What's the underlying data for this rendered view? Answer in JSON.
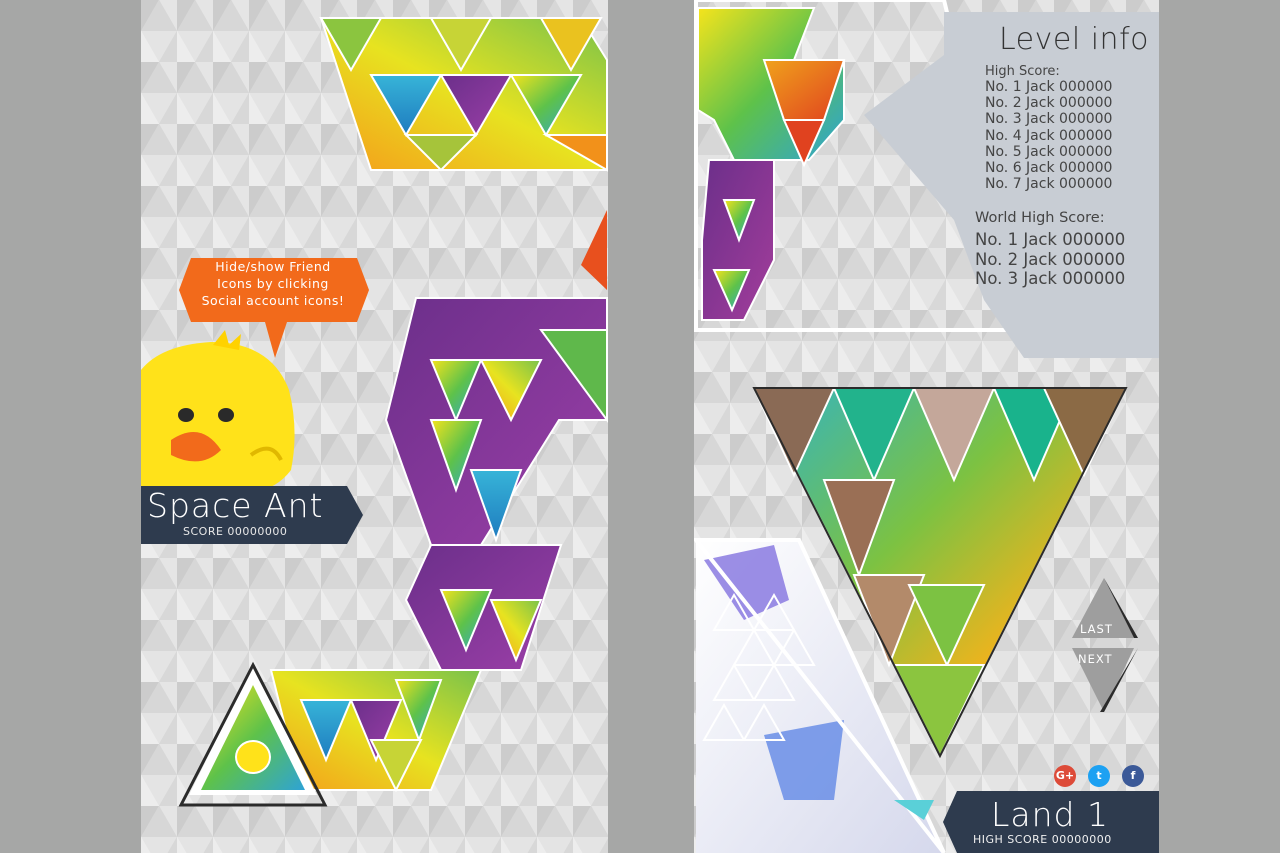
{
  "left_screen": {
    "tooltip_lines": [
      "Hide/show Friend",
      "Icons by clicking",
      "Social account icons!"
    ],
    "player_name": "Space Ant",
    "score_text": "SCORE 00000000",
    "character": "chick-character"
  },
  "right_screen": {
    "level_info_title": "Level info",
    "high_score_label": "High Score:",
    "high_scores": [
      "No. 1 Jack 000000",
      "No. 2 Jack 000000",
      "No. 3 Jack 000000",
      "No. 4 Jack 000000",
      "No. 5 Jack 000000",
      "No. 6 Jack 000000",
      "No. 7 Jack 000000"
    ],
    "world_high_score_label": "World High Score:",
    "world_high_scores": [
      "No. 1 Jack 000000",
      "No. 2 Jack 000000",
      "No. 3 Jack 000000"
    ],
    "last_label": "LAST",
    "next_label": "NEXT",
    "land_title": "Land 1",
    "land_high_score": "HIGH SCORE 00000000",
    "social_icons": [
      "google-plus-icon",
      "twitter-icon",
      "facebook-icon"
    ],
    "social_labels": [
      "G+",
      "t",
      "f"
    ]
  },
  "colors": {
    "tooltip": "#f26a1b",
    "banner": "#2e3b4e",
    "panel": "#c8cdd4",
    "chick": "#ffe21a",
    "beak": "#f26a1b",
    "nav_arrow": "#9e9e9e",
    "google": "#dd4b39",
    "twitter": "#1da1f2",
    "facebook": "#3b5998"
  }
}
